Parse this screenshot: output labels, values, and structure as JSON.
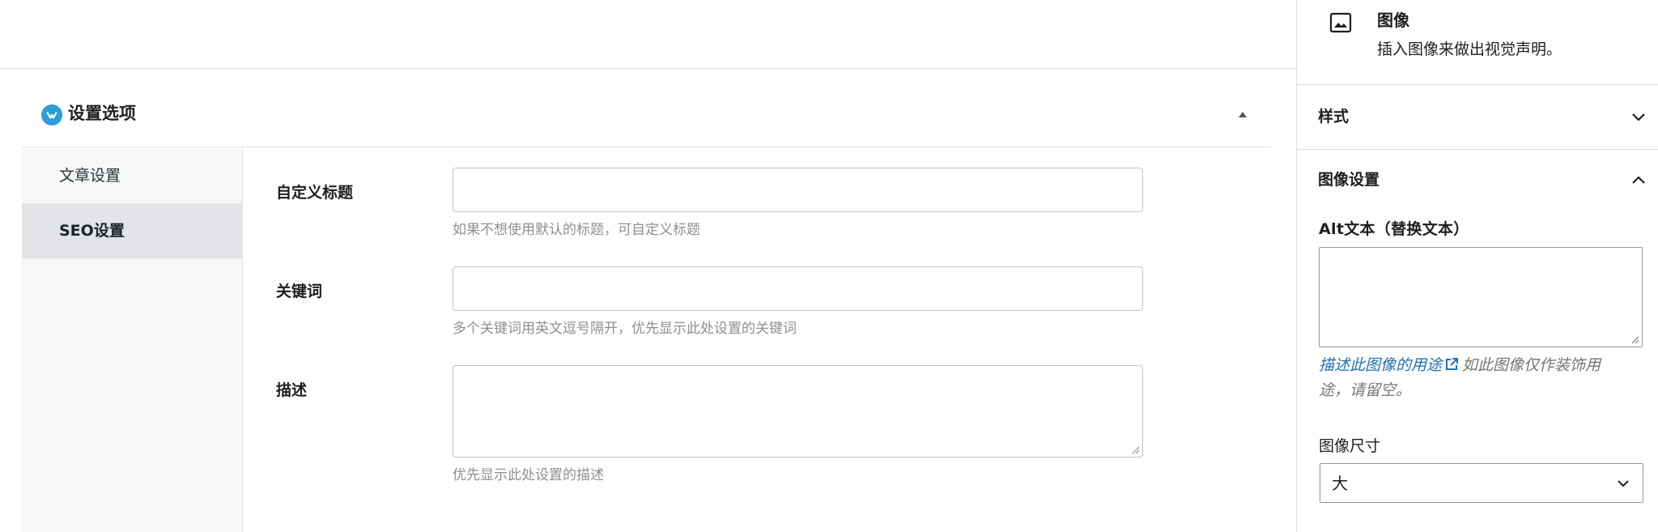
{
  "metabox": {
    "title": "设置选项",
    "nav": [
      {
        "label": "文章设置"
      },
      {
        "label": "SEO设置"
      }
    ],
    "active_nav": "SEO设置",
    "fields": [
      {
        "label": "自定义标题",
        "value": "",
        "help": "如果不想使用默认的标题，可自定义标题"
      },
      {
        "label": "关键词",
        "value": "",
        "help": "多个关键词用英文逗号隔开，优先显示此处设置的关键词"
      },
      {
        "label": "描述",
        "value": "",
        "help": "优先显示此处设置的描述"
      }
    ]
  },
  "sidebar": {
    "block": {
      "icon": "image-icon",
      "name": "图像",
      "description": "插入图像来做出视觉声明。"
    },
    "panels": [
      {
        "title": "样式",
        "expanded": false
      },
      {
        "title": "图像设置",
        "expanded": true
      }
    ],
    "image_settings": {
      "alt_label": "Alt文本（替换文本）",
      "alt_value": "",
      "alt_help_link": "描述此图像的用途",
      "alt_help_text_1": "如此图像仅作装饰用",
      "alt_help_text_2": "途，请留空。",
      "size_label": "图像尺寸",
      "size_value": "大"
    }
  },
  "colors": {
    "link": "#2271b1",
    "logo": "#2d9cdb",
    "nav_active_bg": "#e2e4e7",
    "nav_bg": "#f6f7f7"
  }
}
